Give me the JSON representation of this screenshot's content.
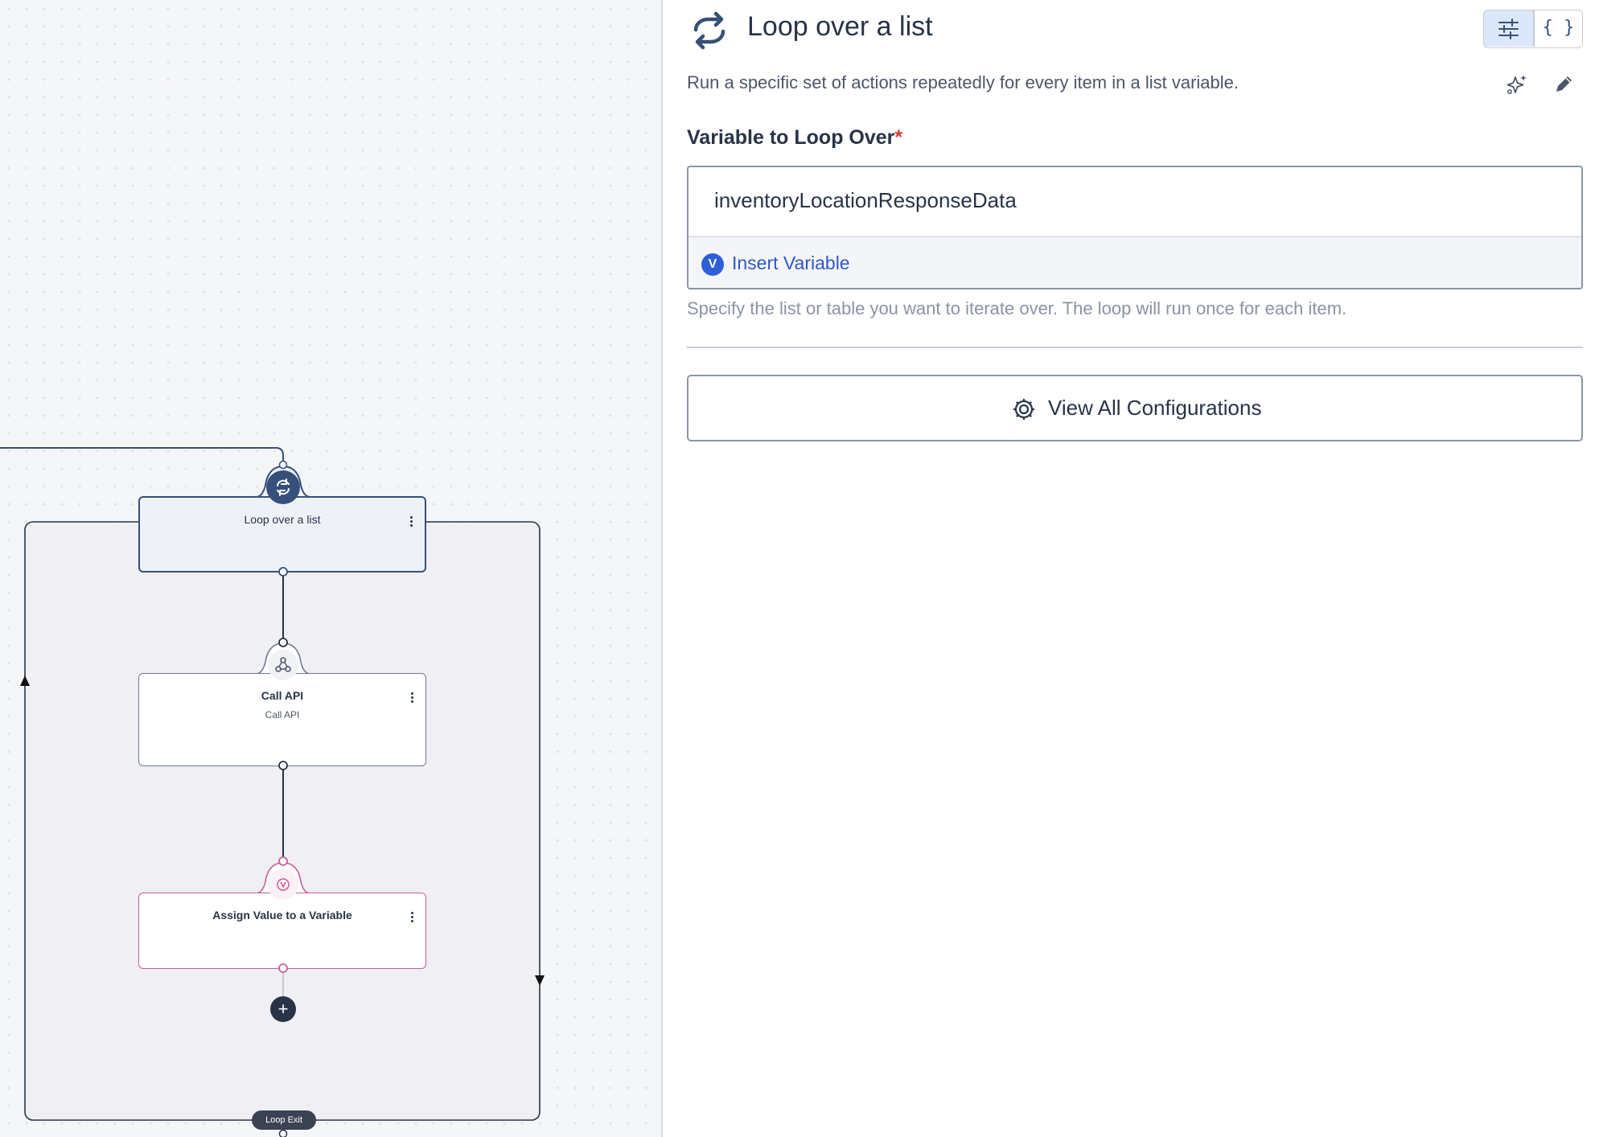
{
  "canvas": {
    "nodes": {
      "loop": {
        "title": "Loop over a list"
      },
      "call_api": {
        "title": "Call API",
        "subtitle": "Call API"
      },
      "assign": {
        "title": "Assign Value to a Variable"
      }
    },
    "add_step_symbol": "+",
    "loop_exit_label": "Loop Exit"
  },
  "panel": {
    "title": "Loop over a list",
    "description": "Run a specific set of actions repeatedly for every item in a list variable.",
    "field_label": "Variable to Loop Over",
    "required_mark": "*",
    "variable_value": "inventoryLocationResponseData",
    "variable_badge": "V",
    "insert_variable_label": "Insert Variable",
    "hint": "Specify the list or table you want to iterate over. The loop will run once for each item.",
    "view_configurations_label": "View All Configurations",
    "view_toggle": {
      "code_label": "{ }"
    }
  },
  "icons": {
    "loop": "loop-arrows-icon",
    "api": "webhook-icon",
    "variable": "variable-icon",
    "settings": "gear-icon",
    "ai": "sparkles-icon",
    "edit": "pencil-icon",
    "form_view": "sliders-icon"
  },
  "colors": {
    "primary": "#35507a",
    "link": "#2e58c9",
    "assign_accent": "#c75e9b",
    "required": "#d93a3a"
  }
}
